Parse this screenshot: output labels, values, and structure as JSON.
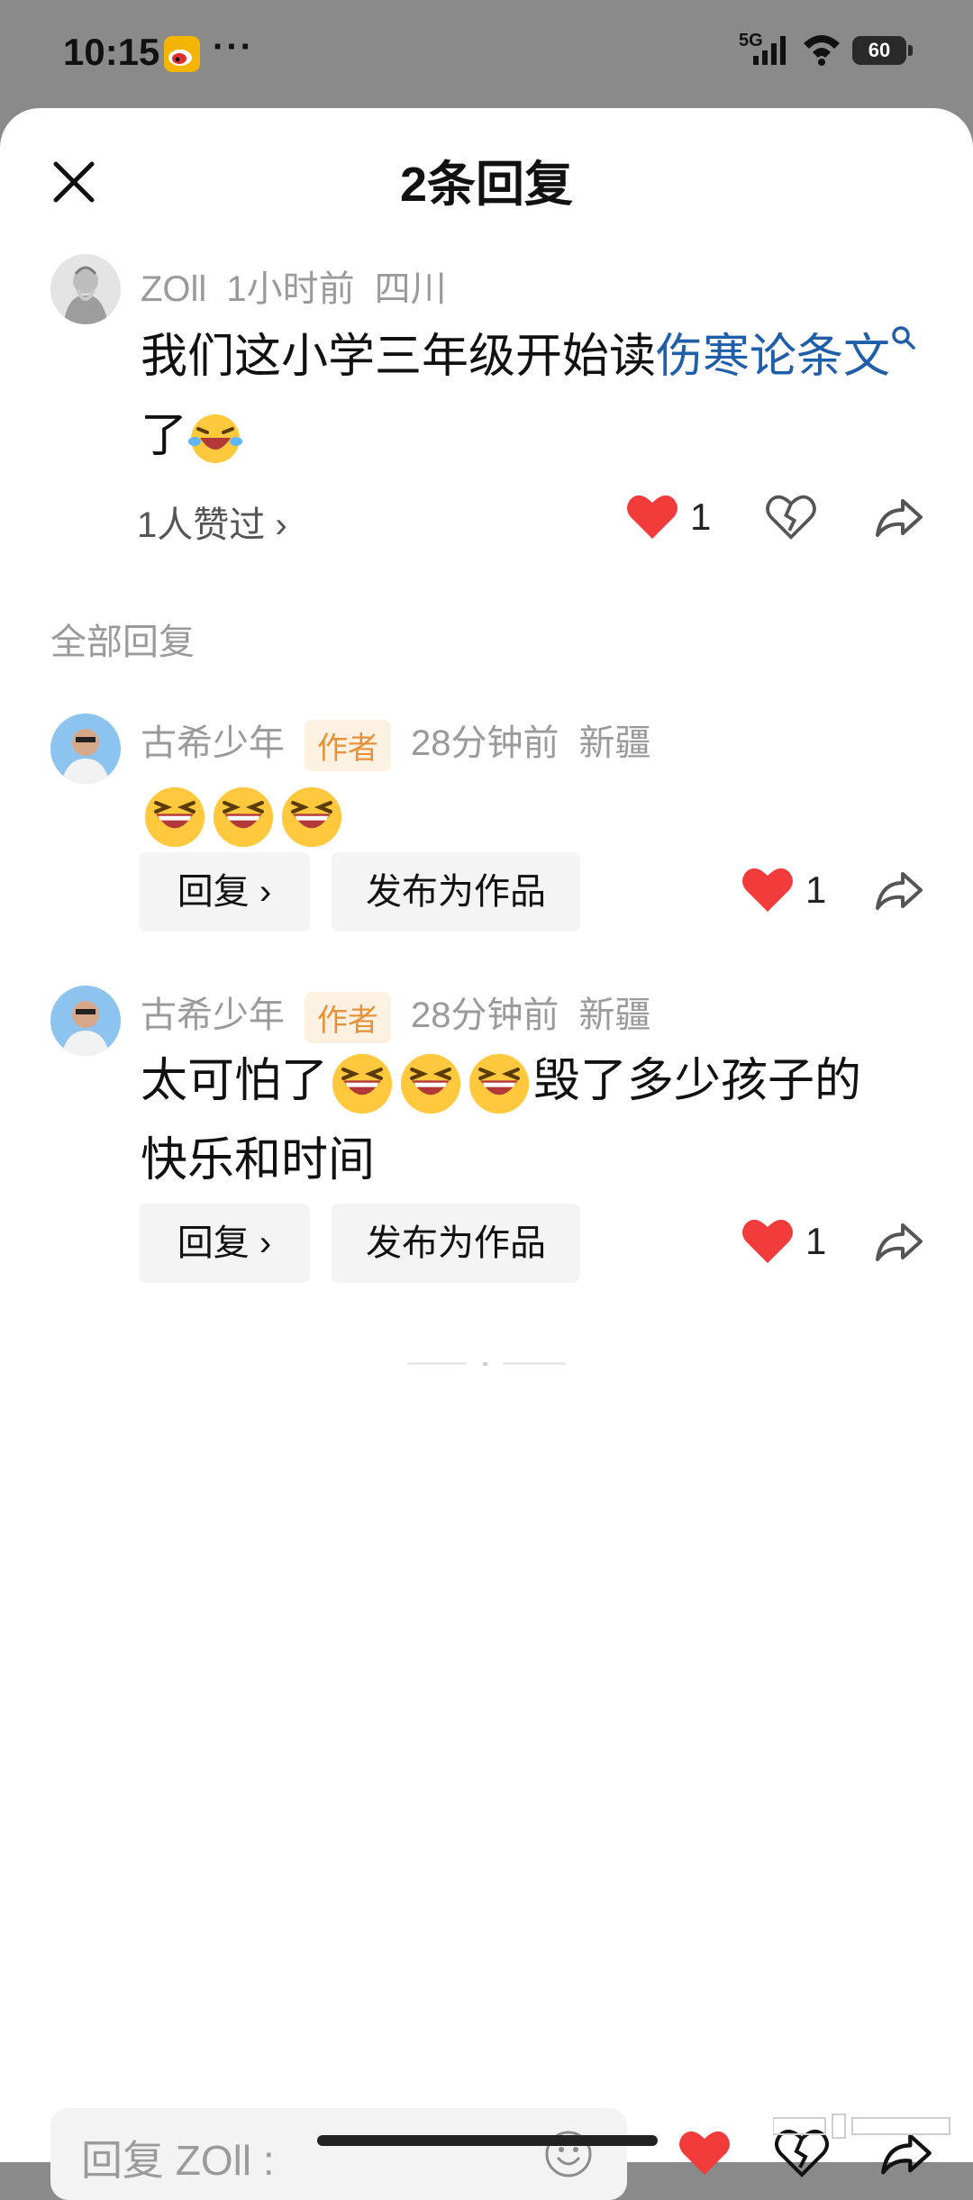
{
  "status_bar": {
    "time": "10:15",
    "more": "···",
    "network": "5G",
    "battery": "60"
  },
  "sheet": {
    "title": "2条回复"
  },
  "original_comment": {
    "username": "ZOll",
    "time": "1小时前",
    "location": "四川",
    "text_before": "我们这小学三年级开始读",
    "topic_link": "伤寒论条文",
    "text_after": "了",
    "likes_link": "1人赞过 ›",
    "like_count": "1"
  },
  "section": {
    "label": "全部回复"
  },
  "replies": [
    {
      "username": "古希少年",
      "tag": "作者",
      "time": "28分钟前",
      "location": "新疆",
      "reply_label": "回复 ›",
      "publish_label": "发布为作品",
      "like_count": "1"
    },
    {
      "username": "古希少年",
      "tag": "作者",
      "time": "28分钟前",
      "location": "新疆",
      "text_prefix": "太可怕了",
      "text_suffix": "毁了多少孩子的",
      "text_line2": "快乐和时间",
      "reply_label": "回复 ›",
      "publish_label": "发布为作品",
      "like_count": "1"
    }
  ],
  "bottom_bar": {
    "input_placeholder": "回复 ZOll :"
  },
  "colors": {
    "topic_blue": "#1f5ea8",
    "like_red": "#f23b3b",
    "author_tag_bg": "#fdf1e2",
    "author_tag_fg": "#e6923a",
    "sheet_bg": "#ffffff"
  }
}
